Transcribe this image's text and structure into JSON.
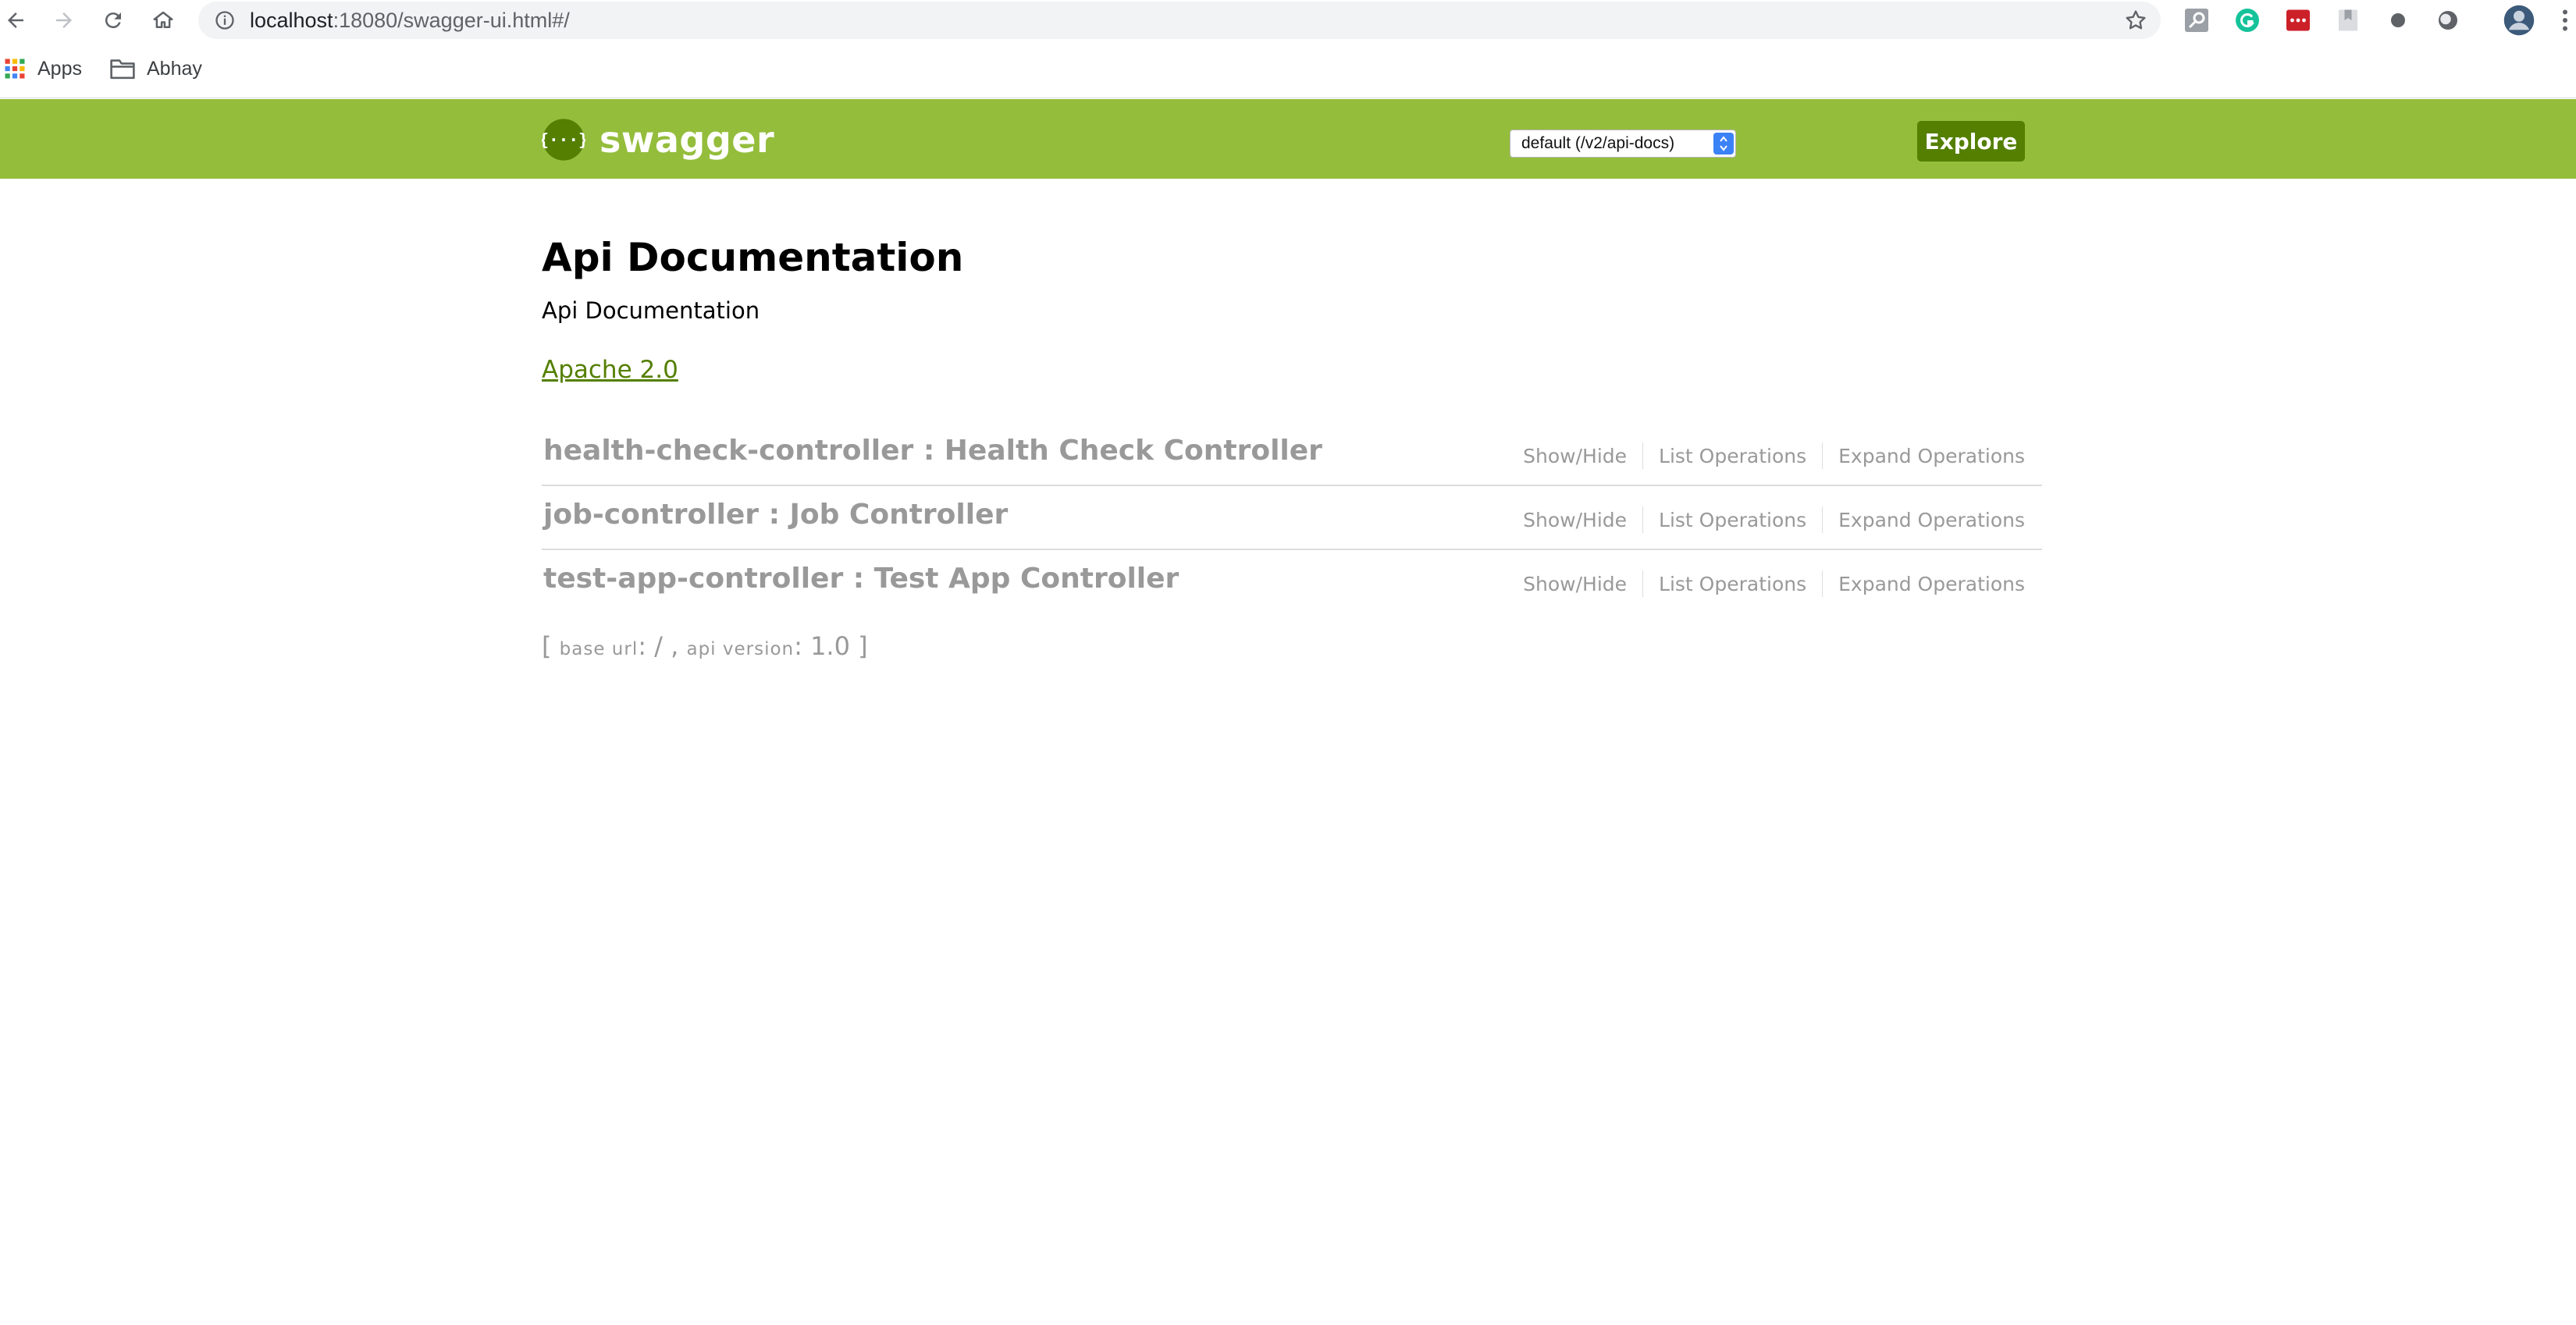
{
  "browser": {
    "url_host": "localhost",
    "url_rest": ":18080/swagger-ui.html#/",
    "bookmarks": [
      {
        "label": "Apps",
        "icon": "apps-grid-icon"
      },
      {
        "label": "Abhay",
        "icon": "folder-icon"
      }
    ],
    "extensions": [
      "search-extension-icon",
      "grammarly-icon",
      "lastpass-icon",
      "bookmark-extension-icon",
      "dot-extension-icon",
      "circle-extension-icon",
      "profile-avatar-icon"
    ]
  },
  "header": {
    "logo_text": "swagger",
    "spec_select": "default (/v2/api-docs)",
    "explore_label": "Explore",
    "colors": {
      "bar": "#94bd3c",
      "explore": "#547f00"
    }
  },
  "info": {
    "title": "Api Documentation",
    "description": "Api Documentation",
    "license": "Apache 2.0"
  },
  "resources": [
    {
      "heading": "health-check-controller : Health Check Controller",
      "ops": [
        "Show/Hide",
        "List Operations",
        "Expand Operations"
      ]
    },
    {
      "heading": "job-controller : Job Controller",
      "ops": [
        "Show/Hide",
        "List Operations",
        "Expand Operations"
      ]
    },
    {
      "heading": "test-app-controller : Test App Controller",
      "ops": [
        "Show/Hide",
        "List Operations",
        "Expand Operations"
      ]
    }
  ],
  "footer": {
    "open": "[",
    "base_url_label": "base url",
    "base_url_value": ": / ,",
    "api_version_label": "api version",
    "api_version_value": ": 1.0",
    "close": "]"
  }
}
